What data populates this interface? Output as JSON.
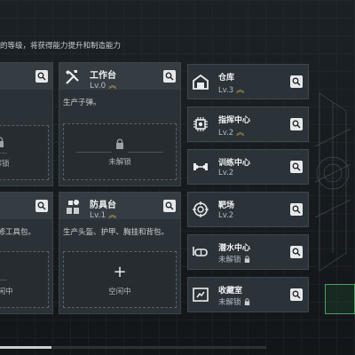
{
  "top_description": "的等级，将获得能力提升和制造能力",
  "left_column": {
    "top_slot_text": "解锁",
    "bottom_desc": "维修工具包。",
    "bottom_slot_text": "空闲中"
  },
  "middle_column": {
    "workbench": {
      "title": "工作台",
      "level": "Lv.0",
      "icon": "tools-icon",
      "desc": "生产子弹。",
      "slot_text": "未解锁"
    },
    "armor_bench": {
      "title": "防具台",
      "level": "Lv.1",
      "icon": "armor-icon",
      "desc": "生产头盔、护甲、胸挂和背包。",
      "slot_text": "空闲中",
      "slot_symbol": "+"
    }
  },
  "right_column": [
    {
      "title": "仓库",
      "level": "Lv.3",
      "icon": "warehouse-icon",
      "upgrade": true,
      "locked": false
    },
    {
      "title": "指挥中心",
      "level": "Lv.2",
      "icon": "command-chip-icon",
      "upgrade": true,
      "locked": false
    },
    {
      "title": "训练中心",
      "level": "Lv.2",
      "icon": "dumbbell-icon",
      "upgrade": false,
      "locked": false
    },
    {
      "title": "靶场",
      "level": "Lv.2",
      "icon": "target-icon",
      "upgrade": false,
      "locked": false
    },
    {
      "title": "潜水中心",
      "level": "未解锁",
      "icon": "diving-mask-icon",
      "upgrade": false,
      "locked": true
    },
    {
      "title": "收藏室",
      "level": "未解锁",
      "icon": "collection-icon",
      "upgrade": false,
      "locked": true
    }
  ],
  "colors": {
    "accent_upgrade": "#d8b047",
    "card_bg": "#2b3237",
    "page_bg": "#14191d"
  }
}
